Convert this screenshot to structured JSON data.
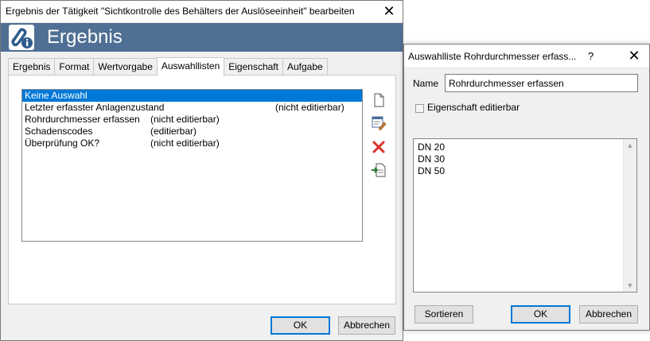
{
  "main_dialog": {
    "title": "Ergebnis der Tätigkeit \"Sichtkontrolle des Behälters der Auslöseeinheit\" bearbeiten",
    "close_glyph": "✕",
    "banner_title": "Ergebnis",
    "tabs": [
      {
        "label": "Ergebnis"
      },
      {
        "label": "Format"
      },
      {
        "label": "Wertvorgabe"
      },
      {
        "label": "Auswahllisten"
      },
      {
        "label": "Eigenschaft"
      },
      {
        "label": "Aufgabe"
      }
    ],
    "active_tab": "Auswahllisten",
    "list": [
      {
        "name": "Keine Auswahl",
        "status": ""
      },
      {
        "name": "Letzter erfasster Anlagenzustand",
        "status": "(nicht editierbar)"
      },
      {
        "name": "Rohrdurchmesser erfassen",
        "status": "(nicht editierbar)"
      },
      {
        "name": "Schadenscodes",
        "status": "(editierbar)"
      },
      {
        "name": "Überprüfung OK?",
        "status": "(nicht editierbar)"
      }
    ],
    "side_buttons": [
      "new-document-icon",
      "edit-list-icon",
      "delete-icon",
      "import-icon"
    ],
    "ok_label": "OK",
    "cancel_label": "Abbrechen"
  },
  "sub_dialog": {
    "title": "Auswahlliste Rohrdurchmesser erfass...",
    "help_glyph": "?",
    "close_glyph": "✕",
    "name_label": "Name",
    "name_value": "Rohrdurchmesser erfassen",
    "checkbox_label": "Eigenschaft editierbar",
    "checkbox_checked": false,
    "items": [
      "DN 20",
      "DN 30",
      "DN 50"
    ],
    "sort_label": "Sortieren",
    "ok_label": "OK",
    "cancel_label": "Abbrechen"
  },
  "colors": {
    "banner": "#4f6f94",
    "selection": "#0078d7",
    "delete_icon": "#d9322c"
  }
}
